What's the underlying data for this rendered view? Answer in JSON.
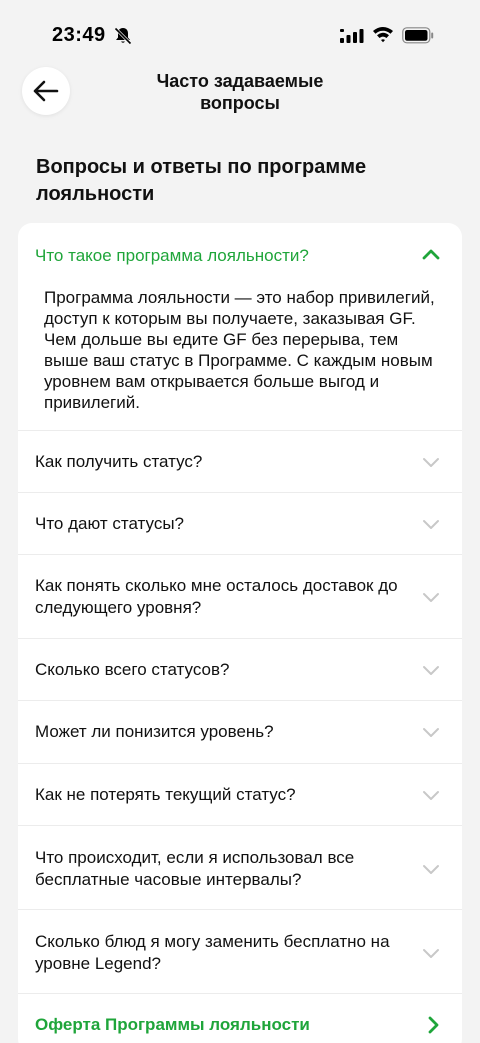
{
  "status_bar": {
    "time": "23:49"
  },
  "header": {
    "title": "Часто задаваемые вопросы"
  },
  "section": {
    "title": "Вопросы и ответы по программе лояльности"
  },
  "faq_open": {
    "question": "Что такое программа лояльности?",
    "answer": "Программа лояльности — это набор привилегий, доступ к которым вы получаете, заказывая GF. Чем дольше вы едите GF без перерыва, тем выше ваш статус в Программе. С каждым новым уровнем вам открывается больше выгод и привилегий."
  },
  "faq_items": [
    {
      "question": "Как получить статус?"
    },
    {
      "question": "Что дают статусы?"
    },
    {
      "question": "Как понять сколько мне осталось доставок до следующего уровня?"
    },
    {
      "question": "Сколько всего статусов?"
    },
    {
      "question": "Может ли понизится уровень?"
    },
    {
      "question": "Как не потерять текущий статус?"
    },
    {
      "question": "Что происходит, если я использовал все бесплатные часовые интервалы?"
    },
    {
      "question": "Сколько блюд я могу заменить бесплатно на уровне Legend?"
    }
  ],
  "offer_link": {
    "label": "Оферта Программы лояльности"
  },
  "colors": {
    "accent": "#1fa53a",
    "chevron_muted": "#c8c8c8",
    "background": "#f3f3f3"
  },
  "icons": [
    "mute-bell-icon",
    "signal-icon",
    "wifi-icon",
    "battery-icon",
    "back-arrow-icon",
    "chevron-up-icon",
    "chevron-down-icon",
    "chevron-right-icon"
  ]
}
